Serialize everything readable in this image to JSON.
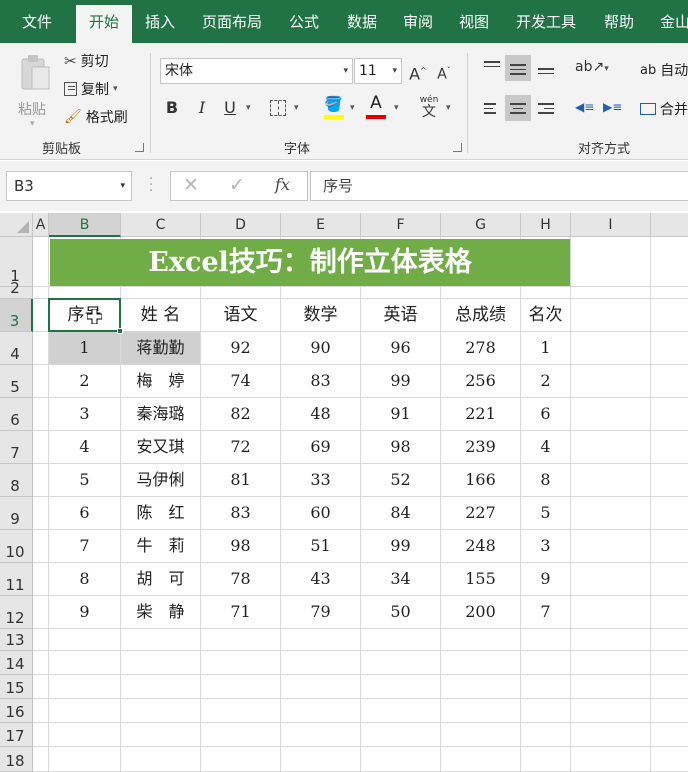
{
  "ribbon_tabs": [
    "文件",
    "开始",
    "插入",
    "页面布局",
    "公式",
    "数据",
    "审阅",
    "视图",
    "开发工具",
    "帮助",
    "金山"
  ],
  "active_tab": "开始",
  "clipboard": {
    "paste_label": "粘贴",
    "cut_label": "剪切",
    "copy_label": "复制",
    "format_painter_label": "格式刷",
    "group_label": "剪贴板"
  },
  "font": {
    "font_name": "宋体",
    "font_size": "11",
    "grow_label": "A",
    "shrink_label": "A",
    "bold_label": "B",
    "italic_label": "I",
    "underline_label": "U",
    "font_color_label": "A",
    "phonetic_label": "wén",
    "phonetic_char": "文",
    "group_label": "字体"
  },
  "alignment": {
    "wrap_label": "自动",
    "merge_label": "合并",
    "group_label": "对齐方式"
  },
  "formula_bar": {
    "name_box": "B3",
    "fx_label": "fx",
    "formula_value": "序号"
  },
  "columns": [
    "A",
    "B",
    "C",
    "D",
    "E",
    "F",
    "G",
    "H",
    "I"
  ],
  "selected_column": "B",
  "rows": [
    "1",
    "2",
    "3",
    "4",
    "5",
    "6",
    "7",
    "8",
    "9",
    "10",
    "11",
    "12",
    "13",
    "14",
    "15",
    "16",
    "17",
    "18"
  ],
  "selected_row": "3",
  "sheet": {
    "title": "Excel技巧：制作立体表格",
    "headers": [
      "序号",
      "姓 名",
      "语文",
      "数学",
      "英语",
      "总成绩",
      "名次"
    ],
    "records": [
      [
        "1",
        "蒋勤勤",
        "92",
        "90",
        "96",
        "278",
        "1"
      ],
      [
        "2",
        "梅　婷",
        "74",
        "83",
        "99",
        "256",
        "2"
      ],
      [
        "3",
        "秦海璐",
        "82",
        "48",
        "91",
        "221",
        "6"
      ],
      [
        "4",
        "安又琪",
        "72",
        "69",
        "98",
        "239",
        "4"
      ],
      [
        "5",
        "马伊俐",
        "81",
        "33",
        "52",
        "166",
        "8"
      ],
      [
        "6",
        "陈　红",
        "83",
        "60",
        "84",
        "227",
        "5"
      ],
      [
        "7",
        "牛　莉",
        "98",
        "51",
        "99",
        "248",
        "3"
      ],
      [
        "8",
        "胡　可",
        "78",
        "43",
        "34",
        "155",
        "9"
      ],
      [
        "9",
        "柴　静",
        "71",
        "79",
        "50",
        "200",
        "7"
      ]
    ]
  },
  "colors": {
    "excel_green": "#217346",
    "title_fill": "#70ad47",
    "selection_gray": "#d0d0d0"
  }
}
